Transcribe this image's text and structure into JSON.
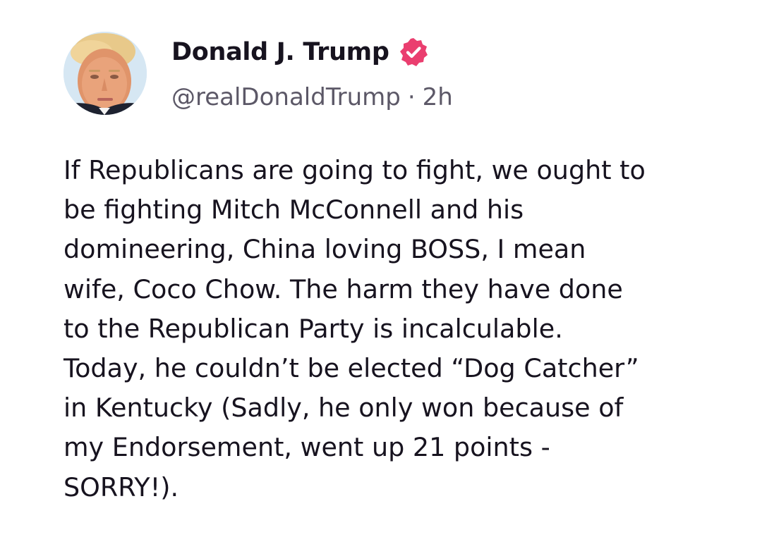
{
  "post": {
    "author": {
      "display_name": "Donald J. Trump",
      "handle": "@realDonaldTrump",
      "verified": true,
      "verified_badge_icon": "verified-badge-icon",
      "avatar_icon": "avatar-photo"
    },
    "separator": "·",
    "time_ago": "2h",
    "body": "If Republicans are going to fight, we ought to\nbe fighting Mitch McConnell and his\ndomineering, China loving BOSS, I mean\nwife, Coco Chow. The harm they have done\nto the Republican Party is incalculable.\nToday, he couldn’t be elected “Dog Catcher”\nin Kentucky (Sadly, he only won because of\nmy Endorsement, went up 21 points -\nSORRY!)."
  },
  "colors": {
    "text_primary": "#17131f",
    "text_secondary": "#5c5867",
    "verified_badge": "#ea3e6f",
    "background": "#ffffff"
  }
}
